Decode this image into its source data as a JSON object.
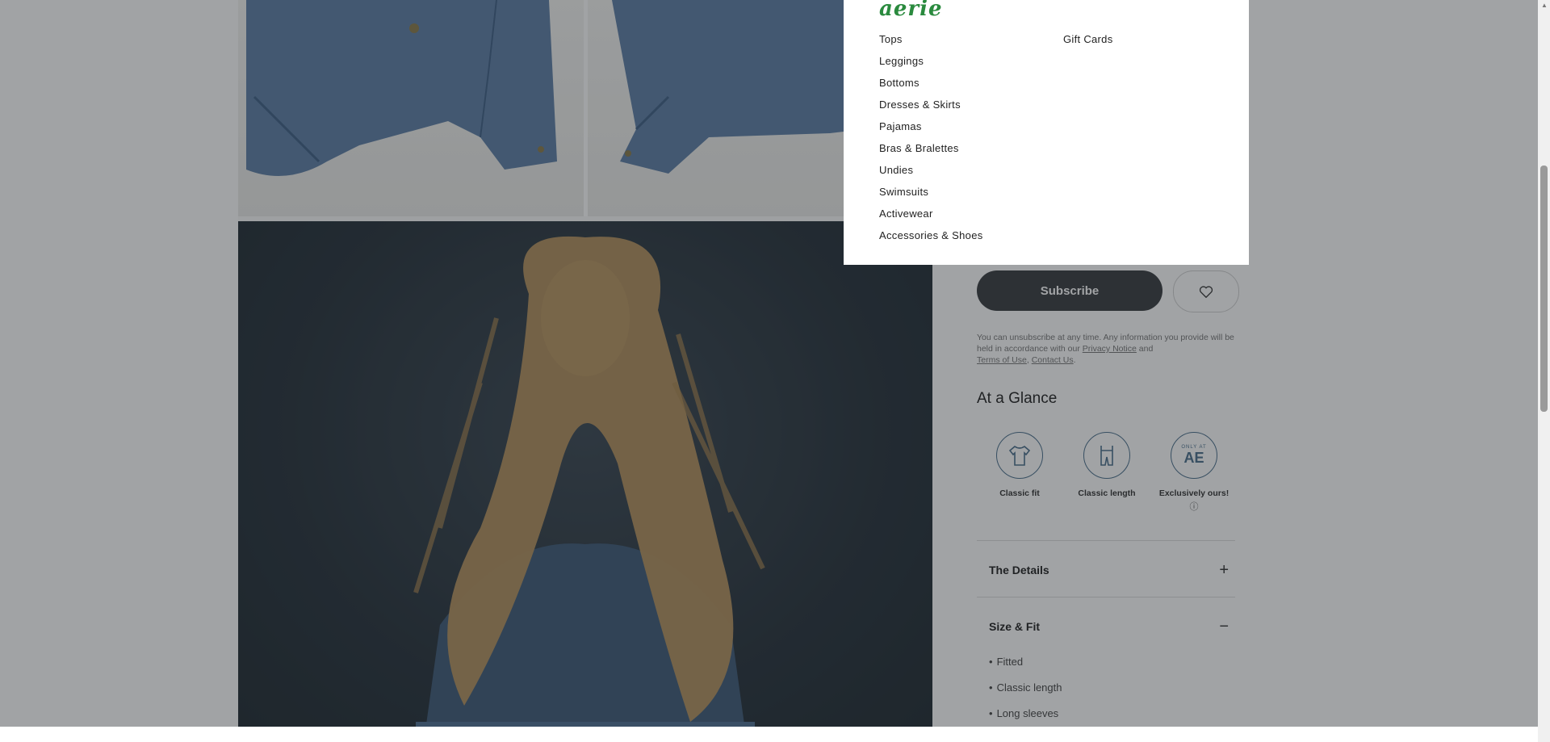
{
  "menu": {
    "brand": "aerie",
    "col1": [
      "Tops",
      "Leggings",
      "Bottoms",
      "Dresses & Skirts",
      "Pajamas",
      "Bras & Bralettes",
      "Undies",
      "Swimsuits",
      "Activewear",
      "Accessories & Shoes"
    ],
    "col2": [
      "Gift Cards"
    ]
  },
  "product": {
    "subscribe_label": "Subscribe",
    "legal_prefix": "You can unsubscribe at any time. Any information you provide will be held in accordance with our",
    "privacy_link": "Privacy Notice",
    "and_text": "and",
    "terms_link": "Terms of Use",
    "contact_link": "Contact Us",
    "glance_title": "At a Glance",
    "glance": [
      {
        "label": "Classic fit",
        "icon": "tshirt-icon"
      },
      {
        "label": "Classic length",
        "icon": "length-icon"
      },
      {
        "label": "Exclusively ours!",
        "icon": "ae-only-icon",
        "badge_text": "AE",
        "arc_text": "ONLY AT"
      }
    ],
    "accordion": [
      {
        "title": "The Details",
        "toggle": "+"
      },
      {
        "title": "Size & Fit",
        "toggle": "−"
      }
    ],
    "size_fit_bullets": [
      "Fitted",
      "Classic length",
      "Long sleeves"
    ]
  }
}
